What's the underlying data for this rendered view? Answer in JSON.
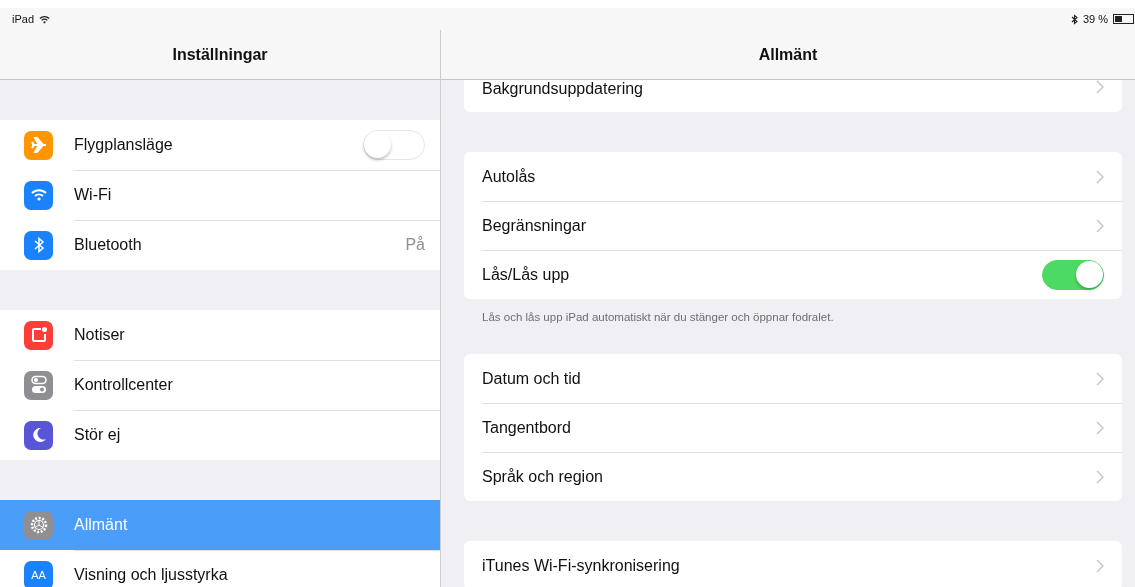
{
  "status_bar": {
    "device": "iPad",
    "battery": "39 %"
  },
  "sidebar": {
    "title": "Inställningar",
    "sections": [
      [
        {
          "label": "Flygplansläge",
          "kind": "airplane",
          "color": "#ff9500",
          "on": false,
          "selected": false
        },
        {
          "label": "Wi-Fi",
          "kind": "wifi",
          "color": "#1a82fb",
          "selected": false
        },
        {
          "label": "Bluetooth",
          "kind": "bluetooth",
          "color": "#1a82fb",
          "value": "På",
          "selected": false
        }
      ],
      [
        {
          "label": "Notiser",
          "kind": "notifications",
          "color": "#fc3d39",
          "selected": false
        },
        {
          "label": "Kontrollcenter",
          "kind": "switches",
          "color": "#8e8e93",
          "selected": false
        },
        {
          "label": "Stör ej",
          "kind": "moon",
          "color": "#5856d6",
          "selected": false
        }
      ],
      [
        {
          "label": "Allmänt",
          "kind": "gear",
          "color": "#8e8e93",
          "selected": true
        },
        {
          "label": "Visning och ljusstyrka",
          "kind": "text",
          "icon_text": "AA",
          "color": "#1a82fb",
          "selected": false
        }
      ]
    ]
  },
  "detail": {
    "title": "Allmänt",
    "groups": [
      {
        "rows": [
          {
            "label": "Bakgrundsuppdatering",
            "kind": "chevron"
          }
        ]
      },
      {
        "rows": [
          {
            "label": "Autolås",
            "kind": "chevron"
          },
          {
            "label": "Begränsningar",
            "kind": "chevron"
          },
          {
            "label": "Lås/Lås upp",
            "kind": "toggle",
            "on": true
          }
        ],
        "footer": "Lås och lås upp iPad automatiskt när du stänger och öppnar fodralet."
      },
      {
        "rows": [
          {
            "label": "Datum och tid",
            "kind": "chevron"
          },
          {
            "label": "Tangentbord",
            "kind": "chevron"
          },
          {
            "label": "Språk och region",
            "kind": "chevron"
          }
        ]
      },
      {
        "rows": [
          {
            "label": "iTunes Wi-Fi-synkronisering",
            "kind": "chevron"
          }
        ]
      }
    ]
  }
}
